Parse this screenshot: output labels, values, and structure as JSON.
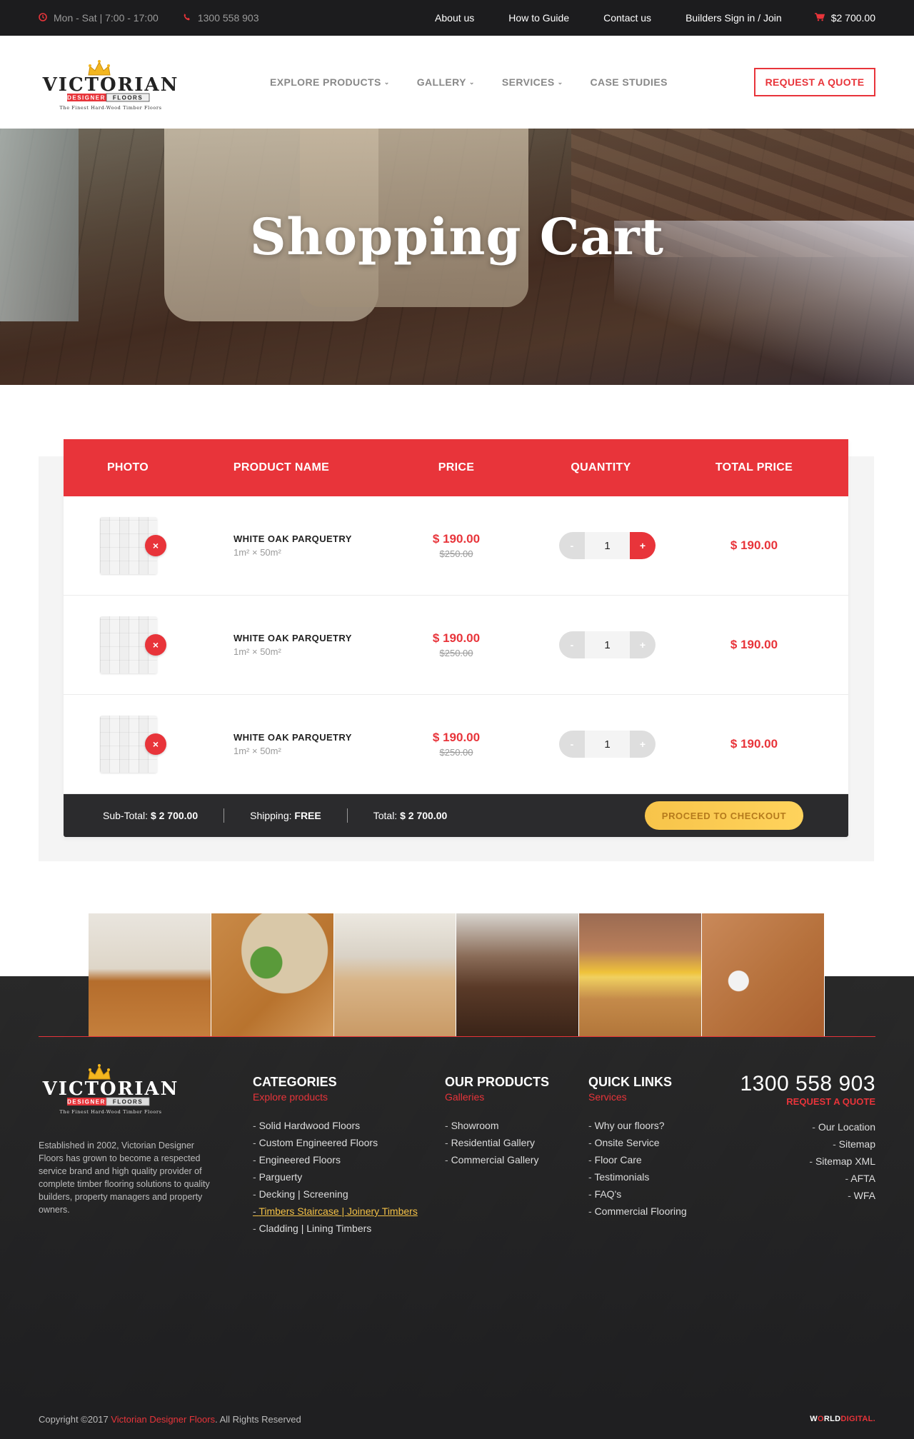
{
  "topbar": {
    "hours": "Mon - Sat | 7:00 - 17:00",
    "phone": "1300 558 903",
    "links": [
      "About us",
      "How to Guide",
      "Contact us",
      "Builders Sign in / Join"
    ],
    "cart_total": "$2 700.00"
  },
  "brand": {
    "name": "VICTORIAN",
    "line2a": "DESIGNER",
    "line2b": "FLOORS",
    "tagline": "The Finest Hard-Wood Timber Floors"
  },
  "nav": {
    "items": [
      "EXPLORE PRODUCTS",
      "GALLERY",
      "SERVICES",
      "CASE STUDIES"
    ],
    "quote": "REQUEST A QUOTE"
  },
  "hero": {
    "title": "Shopping Cart"
  },
  "cart": {
    "headers": [
      "PHOTO",
      "PRODUCT NAME",
      "PRICE",
      "QUANTITY",
      "TOTAL PRICE"
    ],
    "rows": [
      {
        "name": "WHITE OAK PARQUETRY",
        "dims": "1m² × 50m²",
        "price": "$ 190.00",
        "old_price": "$250.00",
        "qty": "1",
        "total": "$ 190.00"
      },
      {
        "name": "WHITE OAK PARQUETRY",
        "dims": "1m² × 50m²",
        "price": "$ 190.00",
        "old_price": "$250.00",
        "qty": "1",
        "total": "$ 190.00"
      },
      {
        "name": "WHITE OAK PARQUETRY",
        "dims": "1m² × 50m²",
        "price": "$ 190.00",
        "old_price": "$250.00",
        "qty": "1",
        "total": "$ 190.00"
      }
    ],
    "minus": "-",
    "plus": "+",
    "remove": "×",
    "subtotal_label": "Sub-Total:",
    "subtotal": "$ 2 700.00",
    "shipping_label": "Shipping:",
    "shipping": "FREE",
    "total_label": "Total:",
    "total": "$ 2 700.00",
    "checkout": "PROCEED TO CHECKOUT"
  },
  "footer": {
    "about": "Established in 2002, Victorian Designer Floors has grown to become a respected service brand and high quality provider of complete timber flooring solutions to quality builders, property managers and property owners.",
    "categories": {
      "title": "CATEGORIES",
      "sub": "Explore products",
      "items": [
        "Solid Hardwood Floors",
        "Custom Engineered Floors",
        "Engineered Floors",
        "Parguerty",
        "Decking | Screening",
        "Timbers Staircase | Joinery Timbers",
        "Cladding | Lining Timbers"
      ]
    },
    "products": {
      "title": "OUR PRODUCTS",
      "sub": "Galleries",
      "items": [
        "Showroom",
        "Residential Gallery",
        "Commercial Gallery"
      ]
    },
    "quick": {
      "title": "QUICK LINKS",
      "sub": "Services",
      "items": [
        "Why our floors?",
        "Onsite Service",
        "Floor Care",
        "Testimonials",
        "FAQ's",
        "Commercial Flooring"
      ]
    },
    "contact": {
      "phone": "1300 558 903",
      "sub": "REQUEST A QUOTE",
      "items": [
        "Our Location",
        "Sitemap",
        "Sitemap XML",
        "AFTA",
        "WFA"
      ]
    },
    "copyright_a": "Copyright ©2017 ",
    "copyright_brand": "Victorian Designer Floors",
    "copyright_b": ". All Rights Reserved",
    "credit_a": "W",
    "credit_o": "O",
    "credit_b": "RLD",
    "credit_c": "DIGITAL."
  },
  "colors": {
    "accent": "#e8343a",
    "dark": "#1c1c1e",
    "checkout": "#f7c44a"
  }
}
